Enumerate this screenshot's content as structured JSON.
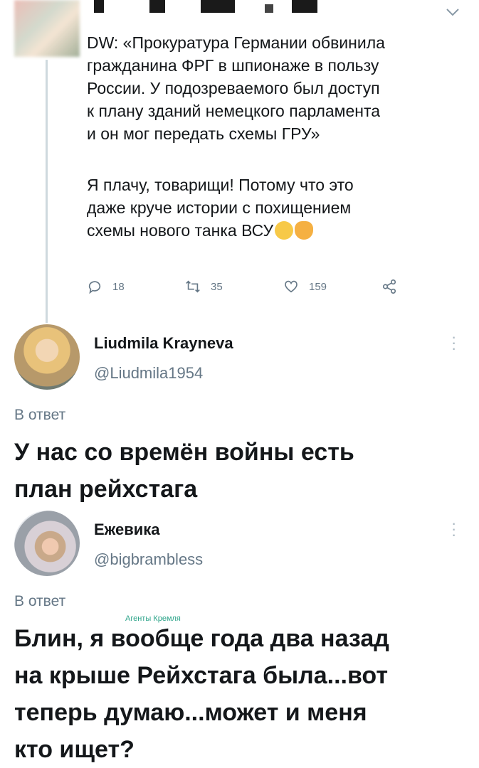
{
  "main_tweet": {
    "paragraph1": "DW: «Прокуратура Германии обвинила\nгражданина ФРГ в шпионаже в пользу\nРоссии. У подозреваемого был доступ\nк плану зданий немецкого парламента\nи он мог передать схемы ГРУ»",
    "paragraph2": "Я плачу, товарищи! Потому что это\nдаже круче истории с похищением\nсхемы нового танка ВСУ",
    "replies": "18",
    "retweets": "35",
    "likes": "159"
  },
  "reply1": {
    "name": "Liudmila Krayneva",
    "handle": "@Liudmila1954",
    "in_reply_to": "В ответ",
    "text": "У нас со времён войны есть\nплан рейхстага"
  },
  "reply2": {
    "name": "Ежевика",
    "handle": "@bigbrambless",
    "in_reply_to": "В ответ",
    "text": "Блин, я вообще года два назад\nна крыше Рейхстага была...вот\nтеперь думаю...может и меня\nкто ищет?"
  },
  "watermark": "Агенты Кремля",
  "colors": {
    "text": "#14171a",
    "secondary": "#657786",
    "thread_line": "#cfd9de"
  },
  "icons": [
    "reply-icon",
    "retweet-icon",
    "like-icon",
    "share-icon",
    "more-icon",
    "chevron-down-icon"
  ]
}
